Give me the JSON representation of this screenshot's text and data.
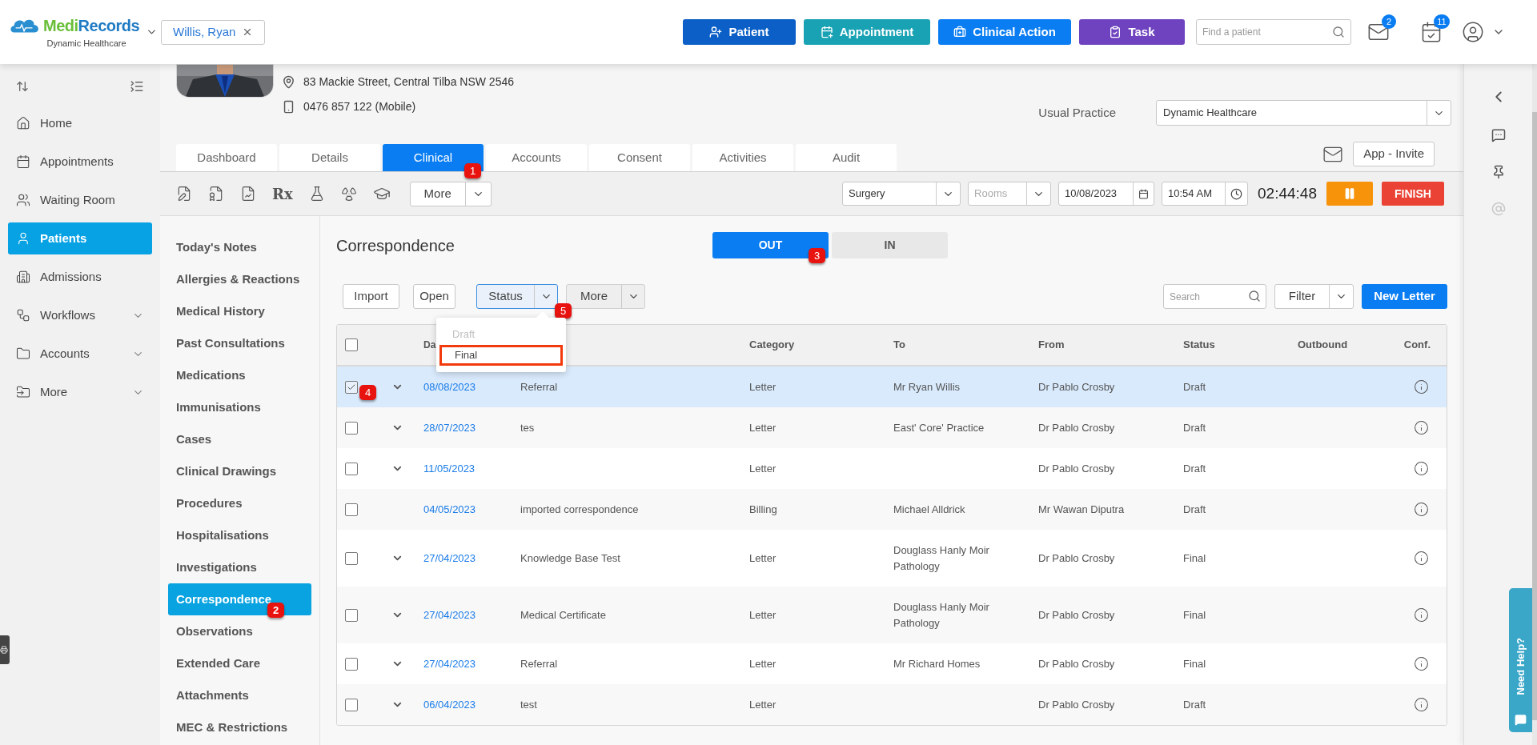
{
  "header": {
    "brand_first": "Medi",
    "brand_second": "Records",
    "practice": "Dynamic Healthcare",
    "patient_tab": "Willis, Ryan",
    "actions": [
      {
        "label": "Patient",
        "kind": "patient"
      },
      {
        "label": "Appointment",
        "kind": "appointment"
      },
      {
        "label": "Clinical Action",
        "kind": "clinical"
      },
      {
        "label": "Task",
        "kind": "task"
      }
    ],
    "search": {
      "placeholder": "Find a patient"
    },
    "mail_badge": "2",
    "calendar_badge": "11"
  },
  "sidebar": {
    "items": [
      {
        "label": "Home",
        "selected": false,
        "has_submenu": false
      },
      {
        "label": "Appointments",
        "selected": false,
        "has_submenu": false
      },
      {
        "label": "Waiting Room",
        "selected": false,
        "has_submenu": false
      },
      {
        "label": "Patients",
        "selected": true,
        "has_submenu": false
      },
      {
        "label": "Admissions",
        "selected": false,
        "has_submenu": false
      },
      {
        "label": "Workflows",
        "selected": false,
        "has_submenu": true
      },
      {
        "label": "Accounts",
        "selected": false,
        "has_submenu": true
      },
      {
        "label": "More",
        "selected": false,
        "has_submenu": true
      }
    ]
  },
  "patient": {
    "address": "83 Mackie Street, Central Tilba NSW 2546",
    "phone": "0476 857 122 (Mobile)",
    "usual_practice": {
      "label": "Usual Practice",
      "value": "Dynamic Healthcare"
    }
  },
  "tabs": [
    {
      "label": "Dashboard",
      "selected": false
    },
    {
      "label": "Details",
      "selected": false
    },
    {
      "label": "Clinical",
      "selected": true,
      "marker": "1"
    },
    {
      "label": "Accounts",
      "selected": false
    },
    {
      "label": "Consent",
      "selected": false
    },
    {
      "label": "Activities",
      "selected": false
    },
    {
      "label": "Audit",
      "selected": false
    }
  ],
  "app_invite": "App - Invite",
  "toolbar": {
    "rx": "Rx",
    "more": "More",
    "location": "Surgery",
    "rooms_placeholder": "Rooms",
    "date": "10/08/2023",
    "time": "10:54 AM",
    "timer": "02:44:48",
    "finish": "FINISH"
  },
  "clinical_nav": [
    {
      "label": "Today's Notes",
      "selected": false
    },
    {
      "label": "Allergies & Reactions",
      "selected": false
    },
    {
      "label": "Medical History",
      "selected": false
    },
    {
      "label": "Past Consultations",
      "selected": false
    },
    {
      "label": "Medications",
      "selected": false
    },
    {
      "label": "Immunisations",
      "selected": false
    },
    {
      "label": "Cases",
      "selected": false
    },
    {
      "label": "Clinical Drawings",
      "selected": false
    },
    {
      "label": "Procedures",
      "selected": false
    },
    {
      "label": "Hospitalisations",
      "selected": false
    },
    {
      "label": "Investigations",
      "selected": false
    },
    {
      "label": "Correspondence",
      "selected": true,
      "marker": "2"
    },
    {
      "label": "Observations",
      "selected": false
    },
    {
      "label": "Extended Care",
      "selected": false
    },
    {
      "label": "Attachments",
      "selected": false
    },
    {
      "label": "MEC & Restrictions",
      "selected": false
    }
  ],
  "correspondence": {
    "title": "Correspondence",
    "direction_tabs": [
      {
        "label": "OUT",
        "selected": true,
        "marker": "3"
      },
      {
        "label": "IN",
        "selected": false
      }
    ],
    "import": "Import",
    "open": "Open",
    "status": "Status",
    "status_marker": "5",
    "more": "More",
    "search": {
      "placeholder": "Search"
    },
    "filter": "Filter",
    "new_letter": "New Letter",
    "status_menu": [
      {
        "label": "Draft",
        "disabled": true,
        "highlighted": false
      },
      {
        "label": "Final",
        "disabled": false,
        "highlighted": true
      }
    ],
    "table": {
      "all_checked": false,
      "columns": {
        "date": "Da",
        "category": "Category",
        "to": "To",
        "from": "From",
        "status": "Status",
        "outbound": "Outbound",
        "conf": "Conf."
      },
      "rows": [
        {
          "selected": true,
          "checked": true,
          "expandable": true,
          "marker": "4",
          "date": "08/08/2023",
          "subject": "Referral",
          "category": "Letter",
          "to": "Mr Ryan Willis",
          "from": "Dr Pablo Crosby",
          "status": "Draft"
        },
        {
          "selected": false,
          "checked": false,
          "expandable": true,
          "date": "28/07/2023",
          "subject": "tes",
          "category": "Letter",
          "to": "East' Core' Practice",
          "from": "Dr Pablo Crosby",
          "status": "Draft"
        },
        {
          "selected": false,
          "checked": false,
          "expandable": true,
          "date": "11/05/2023",
          "category": "Letter",
          "from": "Dr Pablo Crosby",
          "status": "Draft"
        },
        {
          "selected": false,
          "checked": false,
          "expandable": false,
          "date": "04/05/2023",
          "subject": "imported correspondence",
          "category": "Billing",
          "to": "Michael Alldrick",
          "from": "Mr Wawan Diputra",
          "status": "Draft"
        },
        {
          "selected": false,
          "checked": false,
          "expandable": true,
          "date": "27/04/2023",
          "subject": "Knowledge Base Test",
          "category": "Letter",
          "to": "Douglass Hanly Moir Pathology",
          "from": "Dr Pablo Crosby",
          "status": "Final"
        },
        {
          "selected": false,
          "checked": false,
          "expandable": true,
          "date": "27/04/2023",
          "subject": "Medical Certificate",
          "category": "Letter",
          "to": "Douglass Hanly Moir Pathology",
          "from": "Dr Pablo Crosby",
          "status": "Final"
        },
        {
          "selected": false,
          "checked": false,
          "expandable": true,
          "date": "27/04/2023",
          "subject": "Referral",
          "category": "Letter",
          "to": "Mr Richard Homes",
          "from": "Dr Pablo Crosby",
          "status": "Final"
        },
        {
          "selected": false,
          "checked": false,
          "expandable": true,
          "date": "06/04/2023",
          "subject": "test",
          "category": "Letter",
          "from": "Dr Pablo Crosby",
          "status": "Draft"
        }
      ]
    }
  },
  "need_help": "Need Help?"
}
